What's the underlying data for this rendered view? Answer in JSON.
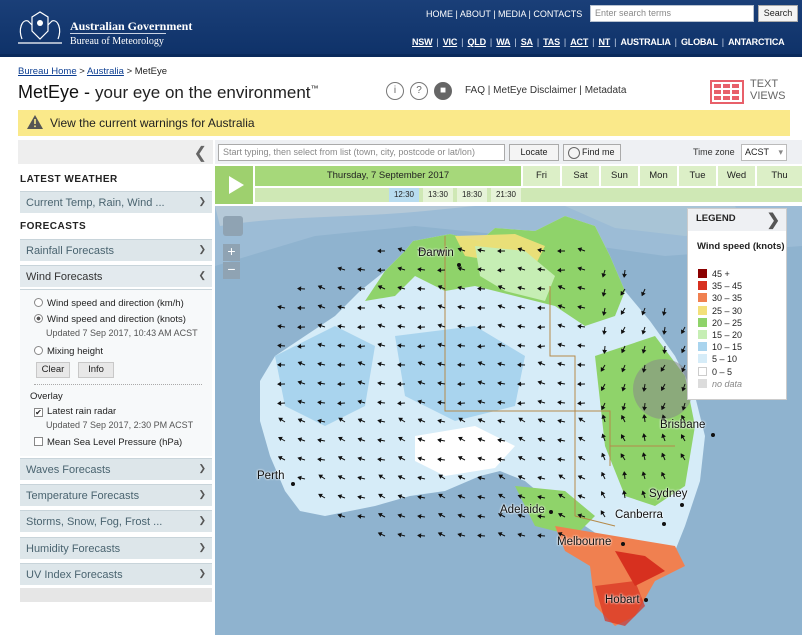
{
  "header": {
    "gov_line1": "Australian Government",
    "gov_line2": "Bureau of Meteorology",
    "nav": [
      "HOME",
      "ABOUT",
      "MEDIA",
      "CONTACTS"
    ],
    "search_placeholder": "Enter search terms",
    "search_button": "Search",
    "states": [
      "NSW",
      "VIC",
      "QLD",
      "WA",
      "SA",
      "TAS",
      "ACT",
      "NT",
      "AUSTRALIA",
      "GLOBAL",
      "ANTARCTICA"
    ]
  },
  "breadcrumb": {
    "home": "Bureau Home",
    "australia": "Australia",
    "current": "MetEye",
    "sep": ">"
  },
  "page": {
    "title": "MetEye",
    "dash": " - ",
    "tagline": "your eye on the environment",
    "tm": "™",
    "links": [
      "FAQ",
      "MetEye Disclaimer",
      "Metadata"
    ],
    "text_views": "TEXT VIEWS"
  },
  "warning": "View the current warnings for Australia",
  "sidebar": {
    "latest_heading": "LATEST WEATHER",
    "current": "Current Temp, Rain, Wind ...",
    "forecasts_heading": "FORECASTS",
    "rainfall": "Rainfall Forecasts",
    "wind": "Wind Forecasts",
    "wind_opt1": "Wind speed and direction (km/h)",
    "wind_opt2": "Wind speed and direction (knots)",
    "wind_updated": "Updated 7 Sep 2017, 10:43 AM ACST",
    "wind_opt3": "Mixing height",
    "clear": "Clear",
    "info": "Info",
    "overlay": "Overlay",
    "radar": "Latest rain radar",
    "radar_updated": "Updated 7 Sep 2017, 2:30 PM ACST",
    "mslp": "Mean Sea Level Pressure (hPa)",
    "waves": "Waves Forecasts",
    "temperature": "Temperature Forecasts",
    "storms": "Storms, Snow, Fog, Frost ...",
    "humidity": "Humidity Forecasts",
    "uv": "UV Index Forecasts"
  },
  "controls": {
    "location_placeholder": "Start typing, then select from list (town, city, postcode or lat/lon)",
    "locate": "Locate",
    "find_me": "Find me",
    "timezone_label": "Time zone",
    "timezone": "ACST"
  },
  "timeline": {
    "day": "Thursday, 7 September 2017",
    "days": [
      "Fri",
      "Sat",
      "Sun",
      "Mon",
      "Tue",
      "Wed",
      "Thu"
    ],
    "hours": [
      "12:30",
      "13:30",
      "18:30",
      "21:30"
    ]
  },
  "map": {
    "cities": [
      "Darwin",
      "Brisbane",
      "Perth",
      "Adelaide",
      "Sydney",
      "Canberra",
      "Melbourne",
      "Hobart"
    ],
    "zoom_in": "+",
    "zoom_out": "−"
  },
  "legend": {
    "heading": "LEGEND",
    "title": "Wind speed (knots)",
    "items": [
      {
        "label": "45 +",
        "color": "#8b0000"
      },
      {
        "label": "35 – 45",
        "color": "#d7301f"
      },
      {
        "label": "30 – 35",
        "color": "#f08050"
      },
      {
        "label": "25 – 30",
        "color": "#f3e07a"
      },
      {
        "label": "20 – 25",
        "color": "#8fd36a"
      },
      {
        "label": "15 – 20",
        "color": "#c6eeb4"
      },
      {
        "label": "10 – 15",
        "color": "#a9d4ee"
      },
      {
        "label": "5 – 10",
        "color": "#d6ecf8"
      },
      {
        "label": "0 – 5",
        "color": "#ffffff"
      },
      {
        "label": "no data",
        "color": "#dcdcdc"
      }
    ]
  }
}
